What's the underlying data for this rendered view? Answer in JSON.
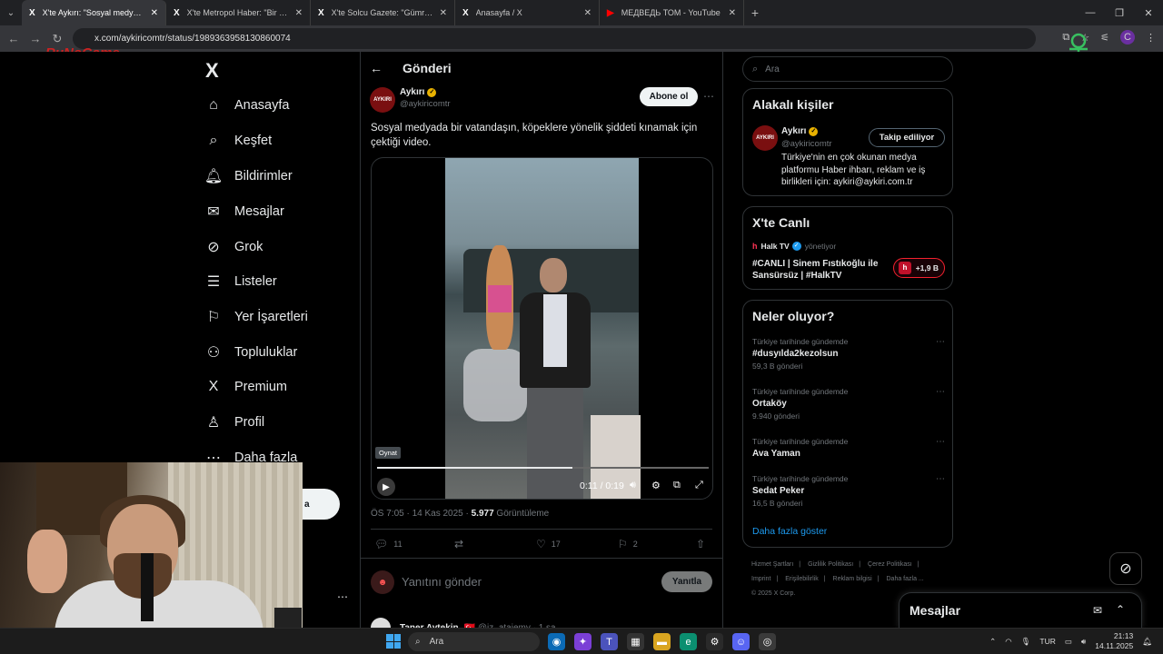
{
  "browser": {
    "tabs": [
      {
        "icon": "X",
        "title": "X'te Aykırı: \"Sosyal medyada bi",
        "active": true
      },
      {
        "icon": "X",
        "title": "X'te Metropol Haber: \"Bir vatan",
        "active": false
      },
      {
        "icon": "X",
        "title": "X'te Solcu Gazete: \"Gümrükte e",
        "active": false
      },
      {
        "icon": "X",
        "title": "Anasayfa / X",
        "active": false
      },
      {
        "icon": "▶",
        "title": "МЕДВЕДЬ ТОМ - YouTube",
        "active": false
      }
    ],
    "url": "x.com/aykiricomtr/status/1989363958130860074",
    "profile_letter": "C"
  },
  "watermark": "RuNoGame",
  "nav": {
    "logo": "X",
    "items": [
      {
        "icon": "⌂",
        "label": "Anasayfa"
      },
      {
        "icon": "⌕",
        "label": "Keşfet"
      },
      {
        "icon": "🔔︎",
        "label": "Bildirimler"
      },
      {
        "icon": "✉",
        "label": "Mesajlar"
      },
      {
        "icon": "⊘",
        "label": "Grok"
      },
      {
        "icon": "☰",
        "label": "Listeler"
      },
      {
        "icon": "⚐",
        "label": "Yer İşaretleri"
      },
      {
        "icon": "⚇",
        "label": "Topluluklar"
      },
      {
        "icon": "X",
        "label": "Premium"
      },
      {
        "icon": "♙",
        "label": "Profil"
      },
      {
        "icon": "⋯",
        "label": "Daha fazla"
      }
    ],
    "post_button_fragment": "a"
  },
  "post": {
    "header": "Gönderi",
    "author_name": "Aykırı",
    "author_handle": "@aykiricomtr",
    "avatar_text": "AYKIRI",
    "follow_label": "Abone ol",
    "text": "Sosyal medyada bir vatandaşın, köpeklere yönelik şiddeti kınamak için çektiği video.",
    "video": {
      "tooltip": "Oynat",
      "time": "0:11 / 0:19",
      "progress": 0.59
    },
    "timestamp": "ÖS 7:05 · 14 Kas 2025 · ",
    "views_count": "5.977",
    "views_label": " Görüntüleme",
    "replies": "11",
    "reposts": "",
    "likes": "17",
    "bookmarks": "2",
    "reply_placeholder": "Yanıtını gönder",
    "reply_button": "Yanıtla",
    "next_reply_author": "Taner Aytekin",
    "next_reply_meta": "🇹🇷 @iz_ataiemy · 1 sa"
  },
  "sidebar": {
    "search_placeholder": "Ara",
    "relevant": {
      "title": "Alakalı kişiler",
      "name": "Aykırı",
      "handle": "@aykiricomtr",
      "button": "Takip ediliyor",
      "bio": "Türkiye'nin en çok okunan medya platformu Haber ihbarı, reklam ve iş birlikleri için: aykiri@aykiri.com.tr"
    },
    "live": {
      "title": "X'te Canlı",
      "source": "Halk TV",
      "source_meta": "yönetiyor",
      "headline": "#CANLI | Sinem Fıstıkoğlu ile Sansürsüz | #HalkTV",
      "badge": "+1,9 B"
    },
    "trends": {
      "title": "Neler oluyor?",
      "items": [
        {
          "context": "Türkiye tarihinde gündemde",
          "name": "#dusyılda2kezolsun",
          "count": "59,3 B gönderi"
        },
        {
          "context": "Türkiye tarihinde gündemde",
          "name": "Ortaköy",
          "count": "9.940 gönderi"
        },
        {
          "context": "Türkiye tarihinde gündemde",
          "name": "Ava Yaman",
          "count": ""
        },
        {
          "context": "Türkiye tarihinde gündemde",
          "name": "Sedat Peker",
          "count": "16,5 B gönderi"
        }
      ],
      "show_more": "Daha fazla göster"
    },
    "footer": [
      "Hizmet Şartları",
      "|",
      "Gizlilik Politikası",
      "|",
      "Çerez Politikası",
      "|",
      "Imprint",
      "|",
      "Erişilebilirlik",
      "|",
      "Reklam bilgisi",
      "|",
      "Daha fazla ...",
      "© 2025 X Corp."
    ]
  },
  "messages_drawer": {
    "title": "Mesajlar"
  },
  "taskbar": {
    "search": "Ara",
    "lang": "TUR",
    "time": "21:13",
    "date": "14.11.2025"
  }
}
